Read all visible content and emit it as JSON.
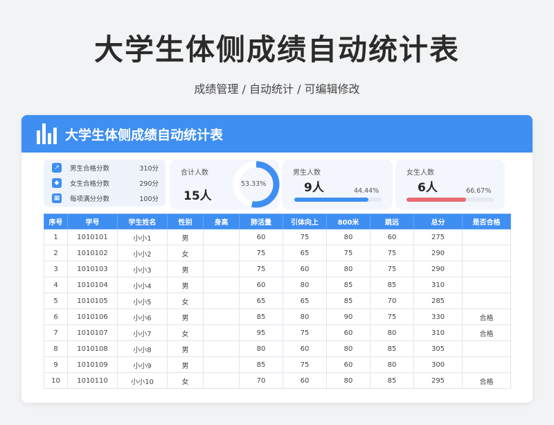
{
  "page": {
    "title": "大学生体侧成绩自动统计表",
    "subtitle": "成绩管理 /  自动统计  /  可编辑修改"
  },
  "card": {
    "header_title": "大学生体侧成绩自动统计表",
    "header_icon": "bar-chart-icon",
    "accent_color": "#3f8ef2"
  },
  "stats": {
    "criteria": [
      {
        "icon": "trend-icon",
        "label": "男生合格分数",
        "value": "310分"
      },
      {
        "icon": "tag-icon",
        "label": "女生合格分数",
        "value": "290分"
      },
      {
        "icon": "grid-icon",
        "label": "每项满分分数",
        "value": "100分"
      }
    ],
    "total": {
      "label": "合计人数",
      "count": "15人",
      "ratio_text": "53.33%",
      "ratio": 0.5333
    },
    "male": {
      "label": "男生人数",
      "count": "9人",
      "ratio_text": "44.44%",
      "ratio": 0.4444,
      "color": "#3f8ef2"
    },
    "female": {
      "label": "女生人数",
      "count": "6人",
      "ratio_text": "66.67%",
      "ratio": 0.6667,
      "color": "#e86a72"
    }
  },
  "table": {
    "headers": [
      "序号",
      "学号",
      "学生姓名",
      "性别",
      "身高",
      "肺活量",
      "引体向上",
      "800米",
      "跳远",
      "总分",
      "是否合格"
    ],
    "rows": [
      [
        "1",
        "1010101",
        "小小1",
        "男",
        "",
        "60",
        "75",
        "80",
        "60",
        "275",
        ""
      ],
      [
        "2",
        "1010102",
        "小小2",
        "女",
        "",
        "75",
        "65",
        "75",
        "75",
        "290",
        ""
      ],
      [
        "3",
        "1010103",
        "小小3",
        "男",
        "",
        "75",
        "60",
        "80",
        "75",
        "290",
        ""
      ],
      [
        "4",
        "1010104",
        "小小4",
        "男",
        "",
        "60",
        "80",
        "85",
        "85",
        "310",
        ""
      ],
      [
        "5",
        "1010105",
        "小小5",
        "女",
        "",
        "65",
        "65",
        "85",
        "70",
        "285",
        ""
      ],
      [
        "6",
        "1010106",
        "小小6",
        "男",
        "",
        "85",
        "80",
        "90",
        "75",
        "330",
        "合格"
      ],
      [
        "7",
        "1010107",
        "小小7",
        "女",
        "",
        "95",
        "75",
        "60",
        "80",
        "310",
        "合格"
      ],
      [
        "8",
        "1010108",
        "小小8",
        "男",
        "",
        "80",
        "60",
        "80",
        "85",
        "305",
        ""
      ],
      [
        "9",
        "1010109",
        "小小9",
        "男",
        "",
        "85",
        "75",
        "60",
        "80",
        "300",
        ""
      ],
      [
        "10",
        "1010110",
        "小小10",
        "女",
        "",
        "70",
        "60",
        "80",
        "85",
        "295",
        "合格"
      ]
    ]
  }
}
